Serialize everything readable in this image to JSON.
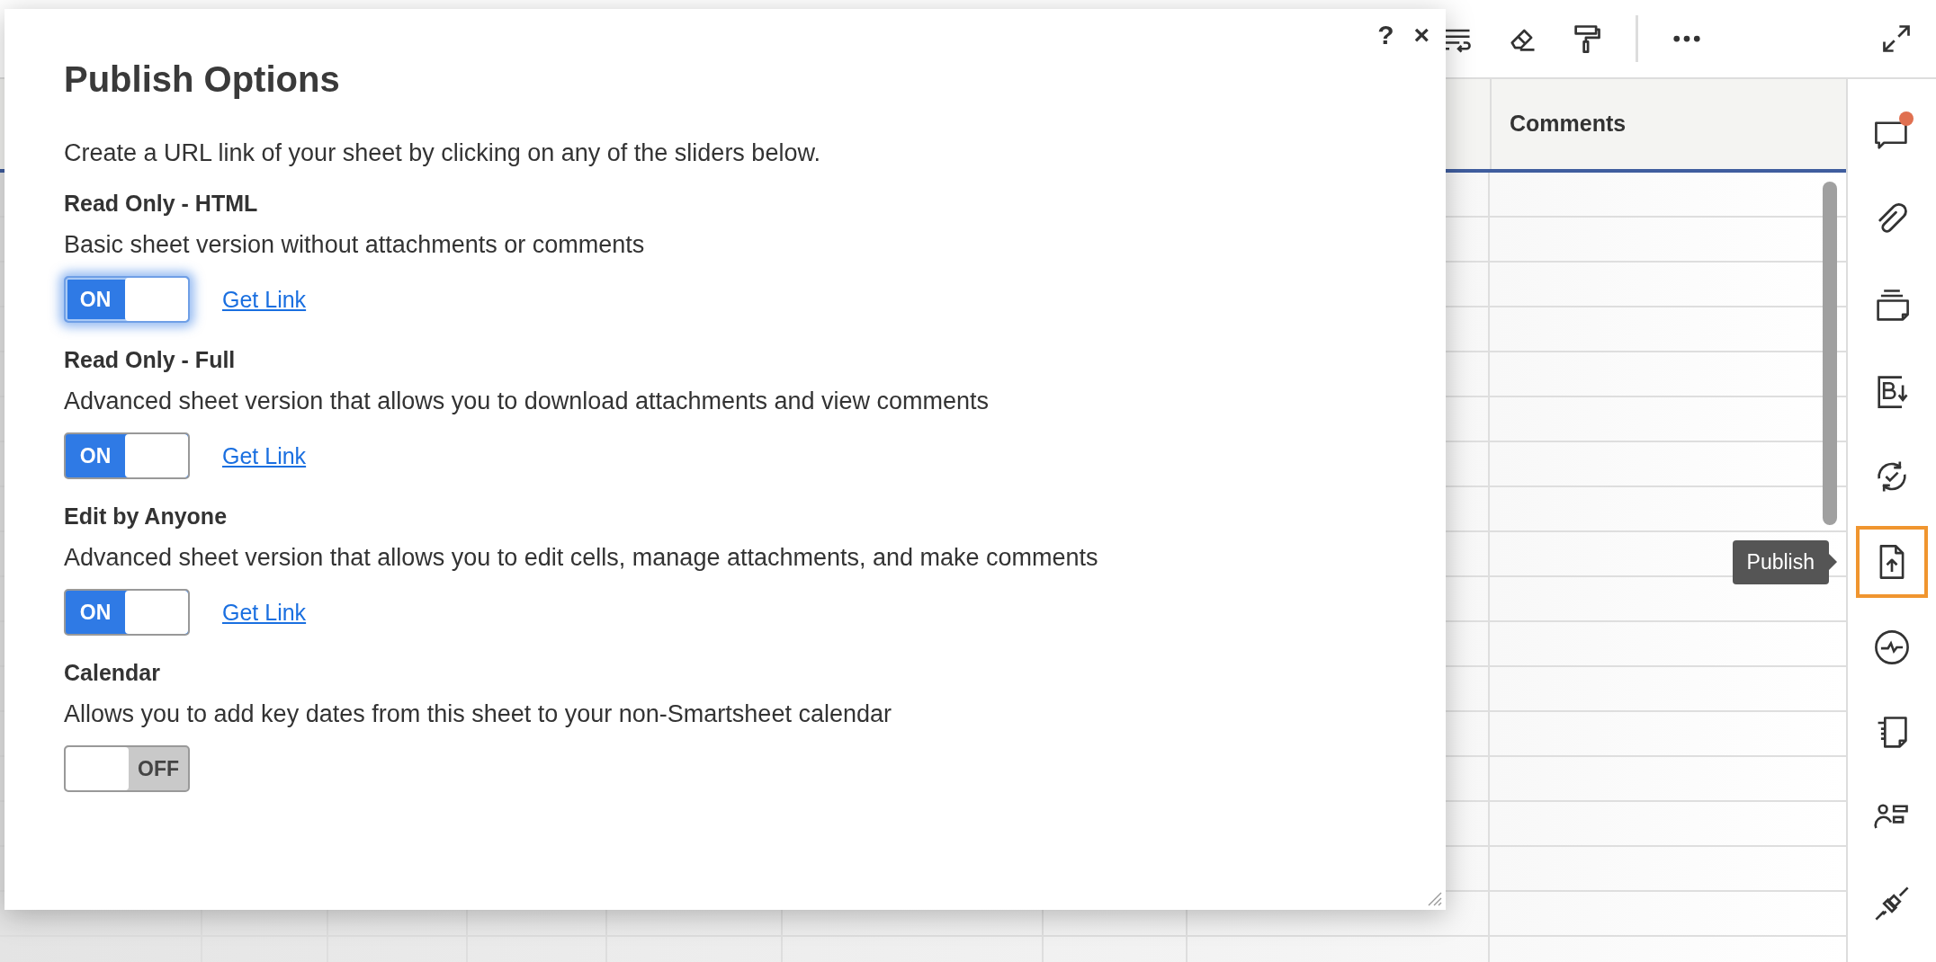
{
  "toolbar": {
    "items": [
      {
        "kind": "wrap"
      },
      {
        "kind": "eraser"
      },
      {
        "kind": "roller"
      },
      {
        "kind": "more"
      }
    ]
  },
  "grid": {
    "columns": [
      {},
      {
        "label": "Comments"
      }
    ]
  },
  "sidebar": {
    "items": [
      {
        "kind": "comment",
        "selected": false,
        "badge": true
      },
      {
        "kind": "attach",
        "selected": false,
        "badge": false
      },
      {
        "kind": "proofs",
        "selected": false,
        "badge": false
      },
      {
        "kind": "bold",
        "selected": false,
        "badge": false
      },
      {
        "kind": "sync",
        "selected": false,
        "badge": false
      },
      {
        "kind": "publish",
        "selected": true,
        "badge": false,
        "tooltip": "Publish"
      },
      {
        "kind": "activity",
        "selected": false,
        "badge": false
      },
      {
        "kind": "forms",
        "selected": false,
        "badge": false
      },
      {
        "kind": "people",
        "selected": false,
        "badge": false
      },
      {
        "kind": "plug",
        "selected": false,
        "badge": false
      }
    ]
  },
  "dialog": {
    "title": "Publish Options",
    "help": "?",
    "close": "×",
    "intro": "Create a URL link of your sheet by clicking on any of the sliders below.",
    "options": [
      {
        "title": "Read Only - HTML",
        "description": "Basic sheet version without attachments or comments",
        "on": true,
        "focused": true,
        "state_label": "ON",
        "link": "Get Link"
      },
      {
        "title": "Read Only - Full",
        "description": "Advanced sheet version that allows you to download attachments and view comments",
        "on": true,
        "focused": false,
        "state_label": "ON",
        "link": "Get Link"
      },
      {
        "title": "Edit by Anyone",
        "description": "Advanced sheet version that allows you to edit cells, manage attachments, and make comments",
        "on": true,
        "focused": false,
        "state_label": "ON",
        "link": "Get Link"
      },
      {
        "title": "Calendar",
        "description": "Allows you to add key dates from this sheet to your non-Smartsheet calendar",
        "on": false,
        "focused": false,
        "state_label": "OFF"
      }
    ]
  }
}
